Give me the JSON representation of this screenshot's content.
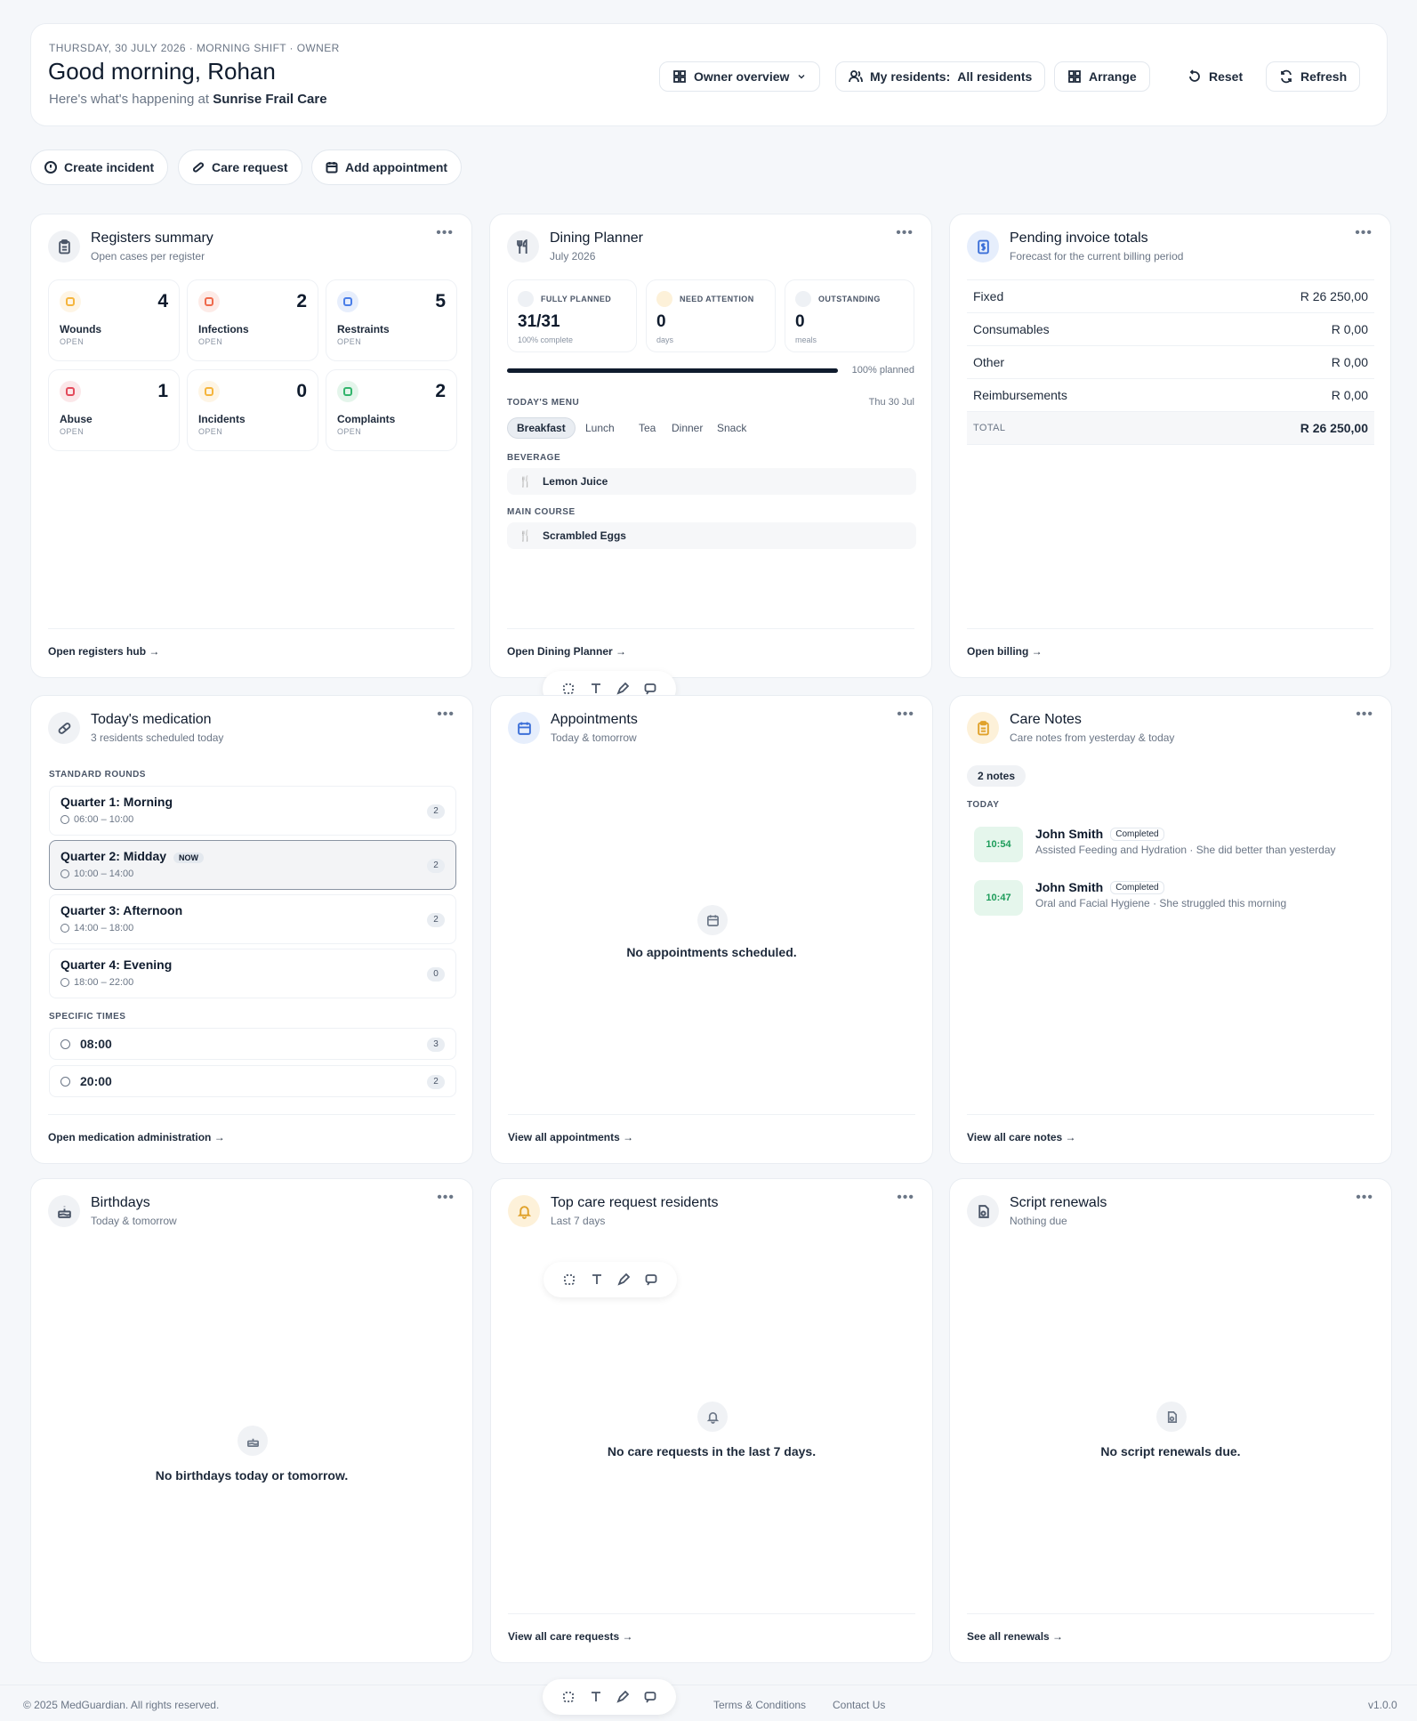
{
  "header": {
    "eyebrow": "THURSDAY, 30 JULY 2026 · MORNING SHIFT · OWNER",
    "greeting": "Good morning, Rohan",
    "subtitle_prefix": "Here's what's happening at",
    "facility": "Sunrise Frail Care",
    "buttons": {
      "overview": "Owner overview",
      "residents_label": "My residents:",
      "residents_value": "All residents",
      "arrange": "Arrange",
      "reset": "Reset",
      "refresh": "Refresh"
    }
  },
  "actions": {
    "incident": "Create incident",
    "care_request": "Care request",
    "appointment": "Add appointment"
  },
  "registers": {
    "title": "Registers summary",
    "subtitle": "Open cases per register",
    "footer": "Open registers hub →",
    "tiles": [
      {
        "label": "Wounds",
        "count": "4",
        "status": "OPEN",
        "color": "#f5b53d"
      },
      {
        "label": "Infections",
        "count": "2",
        "status": "OPEN",
        "color": "#ef6a4c"
      },
      {
        "label": "Restraints",
        "count": "5",
        "status": "OPEN",
        "color": "#4a7ee8"
      },
      {
        "label": "Abuse",
        "count": "1",
        "status": "OPEN",
        "color": "#e34a5b"
      },
      {
        "label": "Incidents",
        "count": "0",
        "status": "OPEN",
        "color": "#f5b53d"
      },
      {
        "label": "Complaints",
        "count": "2",
        "status": "OPEN",
        "color": "#32b56c"
      }
    ]
  },
  "dining": {
    "title": "Dining Planner",
    "subtitle": "July 2026",
    "footer": "Open Dining Planner →",
    "stats": [
      {
        "label": "FULLY PLANNED",
        "value": "31/31",
        "sub": "100% complete"
      },
      {
        "label": "NEED ATTENTION",
        "value": "0",
        "sub": "days"
      },
      {
        "label": "OUTSTANDING",
        "value": "0",
        "sub": "meals"
      }
    ],
    "progress_pct": 100,
    "progress_label": "100% planned",
    "menu_label": "TODAY'S MENU",
    "menu_date": "Thu 30 Jul",
    "tabs": [
      "Breakfast",
      "Lunch",
      "Tea",
      "Dinner",
      "Snack"
    ],
    "active_tab": "Breakfast",
    "beverage_label": "BEVERAGE",
    "beverage": "Lemon Juice",
    "main_label": "MAIN COURSE",
    "main": "Scrambled Eggs"
  },
  "invoices": {
    "title": "Pending invoice totals",
    "subtitle": "Forecast for the current billing period",
    "footer": "Open billing →",
    "rows": [
      {
        "label": "Fixed",
        "value": "R 26 250,00"
      },
      {
        "label": "Consumables",
        "value": "R 0,00"
      },
      {
        "label": "Other",
        "value": "R 0,00"
      },
      {
        "label": "Reimbursements",
        "value": "R 0,00"
      }
    ],
    "total_label": "TOTAL",
    "total_value": "R 26 250,00"
  },
  "medication": {
    "title": "Today's medication",
    "subtitle": "3 residents scheduled today",
    "footer": "Open medication administration →",
    "standard_label": "STANDARD ROUNDS",
    "rounds": [
      {
        "name": "Quarter 1: Morning",
        "time": "06:00 – 10:00",
        "count": "2"
      },
      {
        "name": "Quarter 2: Midday",
        "time": "10:00 – 14:00",
        "count": "2",
        "now": "NOW"
      },
      {
        "name": "Quarter 3: Afternoon",
        "time": "14:00 – 18:00",
        "count": "2"
      },
      {
        "name": "Quarter 4: Evening",
        "time": "18:00 – 22:00",
        "count": "0"
      }
    ],
    "specific_label": "SPECIFIC TIMES",
    "specific": [
      {
        "time": "08:00",
        "count": "3"
      },
      {
        "time": "20:00",
        "count": "2"
      }
    ]
  },
  "appointments": {
    "title": "Appointments",
    "subtitle": "Today & tomorrow",
    "empty": "No appointments scheduled.",
    "footer": "View all appointments →"
  },
  "care_notes": {
    "title": "Care Notes",
    "subtitle": "Care notes from yesterday & today",
    "count": "2 notes",
    "section": "TODAY",
    "footer": "View all care notes →",
    "notes": [
      {
        "time": "10:54",
        "name": "John Smith",
        "status": "Completed",
        "desc": "Assisted Feeding and Hydration · She did better than yesterday"
      },
      {
        "time": "10:47",
        "name": "John Smith",
        "status": "Completed",
        "desc": "Oral and Facial Hygiene · She struggled this morning"
      }
    ]
  },
  "birthdays": {
    "title": "Birthdays",
    "subtitle": "Today & tomorrow",
    "empty": "No birthdays today or tomorrow."
  },
  "care_requests": {
    "title": "Top care request residents",
    "subtitle": "Last 7 days",
    "empty": "No care requests in the last 7 days.",
    "footer": "View all care requests →"
  },
  "scripts": {
    "title": "Script renewals",
    "subtitle": "Nothing due",
    "empty": "No script renewals due.",
    "footer": "See all renewals →"
  },
  "footer": {
    "copyright": "© 2025 MedGuardian. All rights reserved.",
    "terms": "Terms & Conditions",
    "contact": "Contact Us",
    "version": "v1.0.0"
  },
  "icons": [
    "grid-icon",
    "users-icon",
    "rotate-icon",
    "refresh-icon",
    "alert-icon",
    "pill-icon",
    "calendar-icon",
    "clipboard-icon",
    "utensils-icon",
    "invoice-icon",
    "bell-icon",
    "cake-icon",
    "script-icon",
    "clock-icon"
  ]
}
